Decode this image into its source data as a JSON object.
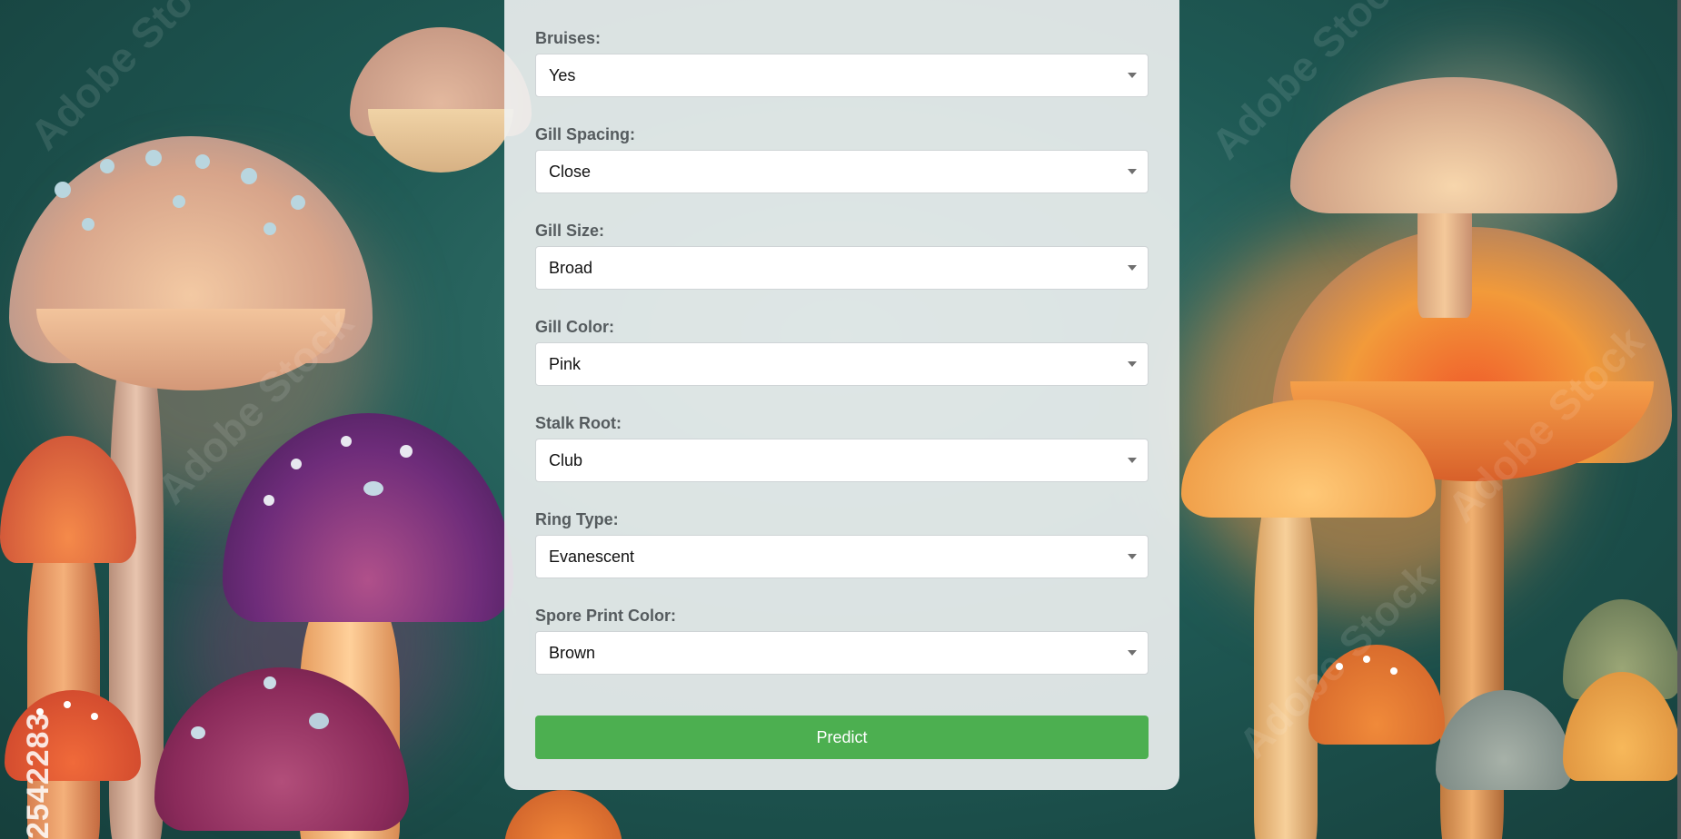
{
  "background": {
    "watermark_id": "2542283",
    "watermark_text": "Adobe Stock",
    "colors": {
      "teal": "#1f5a55",
      "orange_glow": "#f0a04a",
      "red_cap": "#e0603a",
      "purple_cap": "#5a2a6a",
      "magenta_cap": "#8a2a5a",
      "pale_cap": "#d9c2b0"
    }
  },
  "form": {
    "fields": [
      {
        "label": "Bruises:",
        "value": "Yes"
      },
      {
        "label": "Gill Spacing:",
        "value": "Close"
      },
      {
        "label": "Gill Size:",
        "value": "Broad"
      },
      {
        "label": "Gill Color:",
        "value": "Pink"
      },
      {
        "label": "Stalk Root:",
        "value": "Club"
      },
      {
        "label": "Ring Type:",
        "value": "Evanescent"
      },
      {
        "label": "Spore Print Color:",
        "value": "Brown"
      }
    ],
    "submit_label": "Predict",
    "submit_color": "#4caf50"
  }
}
